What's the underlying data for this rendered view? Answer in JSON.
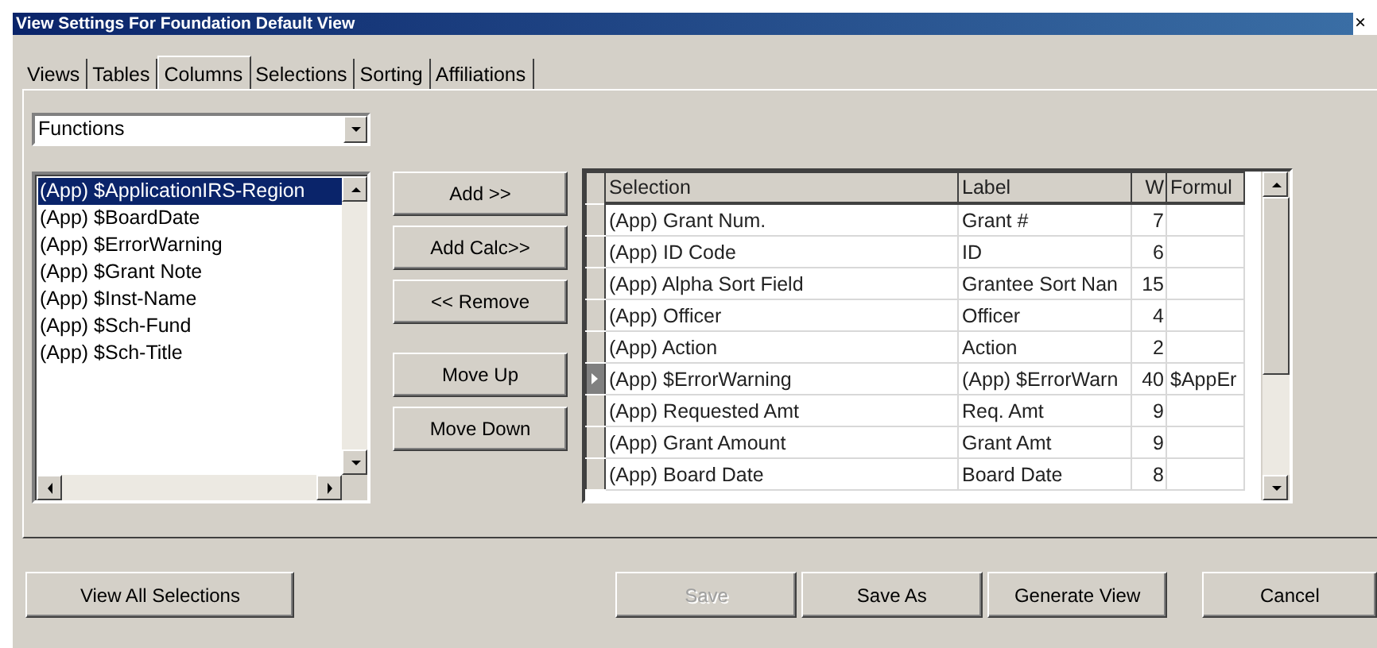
{
  "window": {
    "title": "View Settings For Foundation Default View",
    "close": "×"
  },
  "tabs": [
    {
      "label": "Views",
      "selected": false
    },
    {
      "label": "Tables",
      "selected": false
    },
    {
      "label": "Columns",
      "selected": true
    },
    {
      "label": "Selections",
      "selected": false
    },
    {
      "label": "Sorting",
      "selected": false
    },
    {
      "label": "Affiliations",
      "selected": false
    }
  ],
  "category_dropdown": {
    "value": "Functions"
  },
  "available_list": {
    "items": [
      {
        "label": "(App) $ApplicationIRS-Region",
        "selected": true
      },
      {
        "label": "(App) $BoardDate",
        "selected": false
      },
      {
        "label": "(App) $ErrorWarning",
        "selected": false
      },
      {
        "label": "(App) $Grant Note",
        "selected": false
      },
      {
        "label": "(App) $Inst-Name",
        "selected": false
      },
      {
        "label": "(App) $Sch-Fund",
        "selected": false
      },
      {
        "label": "(App) $Sch-Title",
        "selected": false
      }
    ]
  },
  "action_button_groups": [
    {
      "buttons": [
        "Add >>",
        "Add  Calc>>",
        "<< Remove"
      ]
    },
    {
      "buttons": [
        "Move Up",
        "Move Down"
      ]
    }
  ],
  "columns_grid": {
    "columns": [
      "Selection",
      "Label",
      "W",
      "Formul"
    ],
    "rows": [
      {
        "cells": [
          "(App) Grant Num.",
          "Grant #",
          "7",
          ""
        ],
        "current": false
      },
      {
        "cells": [
          "(App) ID Code",
          "ID",
          "6",
          ""
        ],
        "current": false
      },
      {
        "cells": [
          "(App) Alpha Sort Field",
          "Grantee Sort Nan",
          "15",
          ""
        ],
        "current": false
      },
      {
        "cells": [
          "(App) Officer",
          "Officer",
          "4",
          ""
        ],
        "current": false
      },
      {
        "cells": [
          "(App) Action",
          "Action",
          "2",
          ""
        ],
        "current": false
      },
      {
        "cells": [
          "(App) $ErrorWarning",
          "(App) $ErrorWarn",
          "40",
          "$AppEr"
        ],
        "current": true
      },
      {
        "cells": [
          "(App) Requested Amt",
          "Req. Amt",
          "9",
          ""
        ],
        "current": false
      },
      {
        "cells": [
          "(App) Grant Amount",
          "Grant Amt",
          "9",
          ""
        ],
        "current": false
      },
      {
        "cells": [
          "(App) Board Date",
          "Board Date",
          "8",
          ""
        ],
        "current": false
      }
    ]
  },
  "footer_buttons": [
    {
      "label": "View All Selections",
      "disabled": false,
      "kind": "left"
    },
    {
      "label": "Save",
      "disabled": true,
      "kind": "right"
    },
    {
      "label": "Save As",
      "disabled": false,
      "kind": "right"
    },
    {
      "label": "Generate View",
      "disabled": false,
      "kind": "right"
    },
    {
      "label": "Cancel",
      "disabled": false,
      "kind": "far"
    }
  ]
}
